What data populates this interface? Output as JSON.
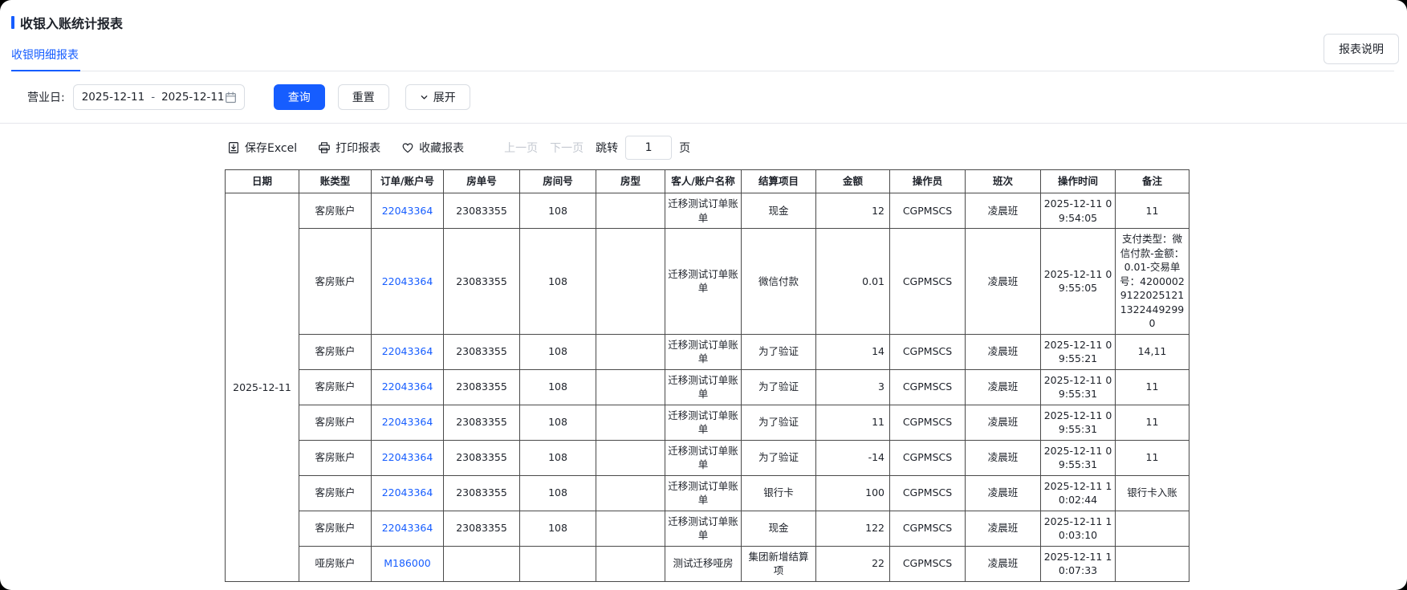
{
  "colors": {
    "accent": "#165dff",
    "link": "#165dff",
    "table_border": "#4a4a4a"
  },
  "page": {
    "title": "收银入账统计报表",
    "report_desc_button": "报表说明",
    "active_tab": "收银明细报表"
  },
  "filters": {
    "business_date_label": "营业日:",
    "date_start": "2025-12-11",
    "date_separator": "-",
    "date_end": "2025-12-11",
    "query_button": "查询",
    "reset_button": "重置",
    "expand_button": "展开"
  },
  "toolbar": {
    "save_excel": "保存Excel",
    "print_report": "打印报表",
    "favorite_report": "收藏报表",
    "prev_page": "上一页",
    "next_page": "下一页",
    "jump_label": "跳转",
    "page_input_value": "1",
    "page_unit": "页"
  },
  "table": {
    "headers": [
      "日期",
      "账类型",
      "订单/账户号",
      "房单号",
      "房间号",
      "房型",
      "客人/账户名称",
      "结算项目",
      "金额",
      "操作员",
      "班次",
      "操作时间",
      "备注"
    ],
    "date_merged": "2025-12-11",
    "rows": [
      {
        "account_type": "客房账户",
        "order_no": "22043364",
        "room_bill_no": "23083355",
        "room_no": "108",
        "room_type": "",
        "guest_name": "迁移测试订单账单",
        "settle_item": "现金",
        "amount": "12",
        "operator": "CGPMSCS",
        "shift": "凌晨班",
        "op_time": "2025-12-11 09:54:05",
        "remark": "11"
      },
      {
        "account_type": "客房账户",
        "order_no": "22043364",
        "room_bill_no": "23083355",
        "room_no": "108",
        "room_type": "",
        "guest_name": "迁移测试订单账单",
        "settle_item": "微信付款",
        "amount": "0.01",
        "operator": "CGPMSCS",
        "shift": "凌晨班",
        "op_time": "2025-12-11 09:55:05",
        "remark": "支付类型：微信付款-金额：0.01-交易单号：4200002912202512113224492990"
      },
      {
        "account_type": "客房账户",
        "order_no": "22043364",
        "room_bill_no": "23083355",
        "room_no": "108",
        "room_type": "",
        "guest_name": "迁移测试订单账单",
        "settle_item": "为了验证",
        "amount": "14",
        "operator": "CGPMSCS",
        "shift": "凌晨班",
        "op_time": "2025-12-11 09:55:21",
        "remark": "14,11"
      },
      {
        "account_type": "客房账户",
        "order_no": "22043364",
        "room_bill_no": "23083355",
        "room_no": "108",
        "room_type": "",
        "guest_name": "迁移测试订单账单",
        "settle_item": "为了验证",
        "amount": "3",
        "operator": "CGPMSCS",
        "shift": "凌晨班",
        "op_time": "2025-12-11 09:55:31",
        "remark": "11"
      },
      {
        "account_type": "客房账户",
        "order_no": "22043364",
        "room_bill_no": "23083355",
        "room_no": "108",
        "room_type": "",
        "guest_name": "迁移测试订单账单",
        "settle_item": "为了验证",
        "amount": "11",
        "operator": "CGPMSCS",
        "shift": "凌晨班",
        "op_time": "2025-12-11 09:55:31",
        "remark": "11"
      },
      {
        "account_type": "客房账户",
        "order_no": "22043364",
        "room_bill_no": "23083355",
        "room_no": "108",
        "room_type": "",
        "guest_name": "迁移测试订单账单",
        "settle_item": "为了验证",
        "amount": "-14",
        "operator": "CGPMSCS",
        "shift": "凌晨班",
        "op_time": "2025-12-11 09:55:31",
        "remark": "11"
      },
      {
        "account_type": "客房账户",
        "order_no": "22043364",
        "room_bill_no": "23083355",
        "room_no": "108",
        "room_type": "",
        "guest_name": "迁移测试订单账单",
        "settle_item": "银行卡",
        "amount": "100",
        "operator": "CGPMSCS",
        "shift": "凌晨班",
        "op_time": "2025-12-11 10:02:44",
        "remark": "银行卡入账"
      },
      {
        "account_type": "客房账户",
        "order_no": "22043364",
        "room_bill_no": "23083355",
        "room_no": "108",
        "room_type": "",
        "guest_name": "迁移测试订单账单",
        "settle_item": "现金",
        "amount": "122",
        "operator": "CGPMSCS",
        "shift": "凌晨班",
        "op_time": "2025-12-11 10:03:10",
        "remark": ""
      },
      {
        "account_type": "哑房账户",
        "order_no": "M186000",
        "room_bill_no": "",
        "room_no": "",
        "room_type": "",
        "guest_name": "测试迁移哑房",
        "settle_item": "集团新增结算项",
        "amount": "22",
        "operator": "CGPMSCS",
        "shift": "凌晨班",
        "op_time": "2025-12-11 10:07:33",
        "remark": ""
      }
    ]
  }
}
